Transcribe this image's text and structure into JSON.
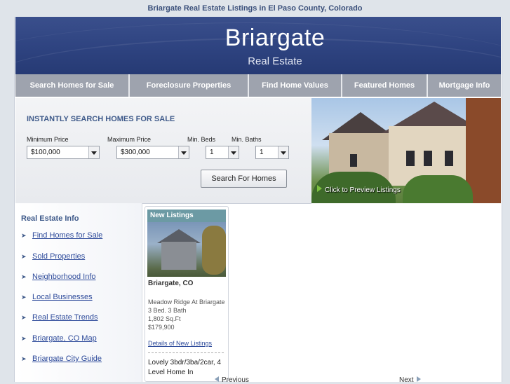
{
  "page_title": "Briargate Real Estate Listings in El Paso County, Colorado",
  "brand": {
    "name": "Briargate",
    "sub": "Real Estate"
  },
  "nav": [
    {
      "label": "Search Homes for Sale"
    },
    {
      "label": "Foreclosure Properties"
    },
    {
      "label": "Find Home Values"
    },
    {
      "label": "Featured Homes"
    },
    {
      "label": "Mortgage Info"
    }
  ],
  "search": {
    "title": "INSTANTLY SEARCH HOMES FOR SALE",
    "min_price_label": "Minimum Price",
    "min_price_value": "$100,000",
    "max_price_label": "Maximum Price",
    "max_price_value": "$300,000",
    "beds_label": "Min. Beds",
    "beds_value": "1",
    "baths_label": "Min. Baths",
    "baths_value": "1",
    "button": "Search For Homes"
  },
  "preview": {
    "link": "Click to Preview Listings"
  },
  "sidebar": {
    "title": "Real Estate Info",
    "items": [
      {
        "label": "Find Homes for Sale"
      },
      {
        "label": "Sold Properties"
      },
      {
        "label": "Neighborhood Info"
      },
      {
        "label": "Local Businesses"
      },
      {
        "label": "Real Estate Trends"
      },
      {
        "label": "Briargate, CO Map"
      },
      {
        "label": "Briargate City Guide"
      }
    ]
  },
  "listing": {
    "header": "New Listings",
    "city": "Briargate, CO",
    "community": "Meadow Ridge At Briargate",
    "beds_baths": "3 Bed. 3 Bath",
    "sqft": "1,802 Sq.Ft",
    "price": "$179,900",
    "details_link": "Details of New Listings",
    "description": "Lovely 3bdr/3ba/2car, 4 Level Home In"
  },
  "pager": {
    "prev": "Previous",
    "next": "Next"
  },
  "colors": {
    "header_bg": "#2e4380",
    "nav_bg": "#9ea3ae",
    "accent_text": "#3f5a8a",
    "link": "#2d4a9a",
    "listing_header": "#6c9aa4"
  }
}
